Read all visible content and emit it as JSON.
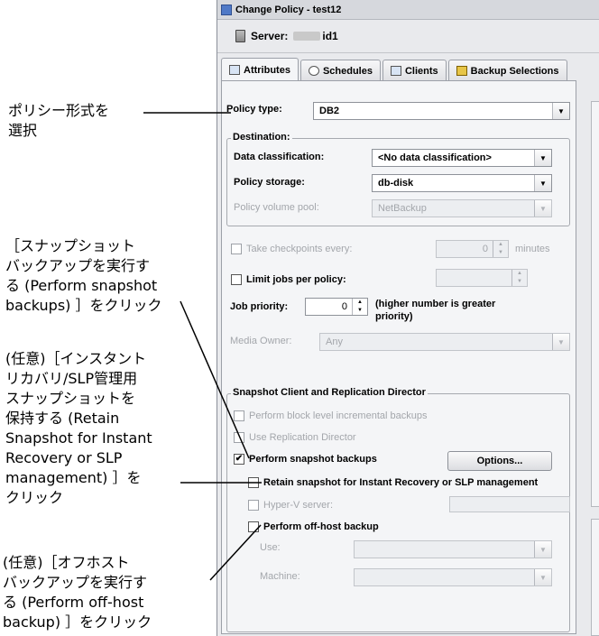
{
  "window": {
    "title": "Change Policy - test12",
    "server_label": "Server:",
    "server_value": "id1"
  },
  "tabs": [
    {
      "label": "Attributes",
      "icon": "attributes-icon",
      "active": true
    },
    {
      "label": "Schedules",
      "icon": "schedules-icon",
      "active": false
    },
    {
      "label": "Clients",
      "icon": "clients-icon",
      "active": false
    },
    {
      "label": "Backup Selections",
      "icon": "backup-selections-icon",
      "active": false
    }
  ],
  "attributes": {
    "policy_type_label": "Policy type:",
    "policy_type_value": "DB2",
    "destination_title": "Destination:",
    "data_classification_label": "Data classification:",
    "data_classification_value": "<No data classification>",
    "policy_storage_label": "Policy storage:",
    "policy_storage_value": "db-disk",
    "policy_volume_pool_label": "Policy volume pool:",
    "policy_volume_pool_value": "NetBackup",
    "take_checkpoints_label": "Take checkpoints every:",
    "take_checkpoints_value": "0",
    "minutes_label": "minutes",
    "limit_jobs_label": "Limit jobs per policy:",
    "job_priority_label": "Job priority:",
    "job_priority_value": "0",
    "job_priority_hint": "(higher number is greater priority)",
    "media_owner_label": "Media Owner:",
    "media_owner_value": "Any"
  },
  "snapshot": {
    "group_title": "Snapshot Client and Replication Director",
    "block_level_label": "Perform block level incremental backups",
    "use_replication_label": "Use Replication Director",
    "perform_snapshot_label": "Perform snapshot backups",
    "perform_snapshot_checked": true,
    "options_button": "Options...",
    "retain_label": "Retain snapshot for Instant Recovery or SLP management",
    "hyperv_label": "Hyper-V server:",
    "offhost_label": "Perform off-host backup",
    "use_label": "Use:",
    "machine_label": "Machine:"
  },
  "callouts": {
    "policy_type": "ポリシー形式を\n選択",
    "perform_snapshot": "［スナップショット\nバックアップを実行す\nる (Perform snapshot\nbackups) ］をクリック",
    "retain": "(任意)［インスタント\nリカバリ/SLP管理用\nスナップショットを\n保持する (Retain\nSnapshot for Instant\nRecovery or SLP\nmanagement) ］を\nクリック",
    "offhost": "(任意)［オフホスト\nバックアップを実行す\nる (Perform off-host\nbackup) ］をクリック"
  }
}
